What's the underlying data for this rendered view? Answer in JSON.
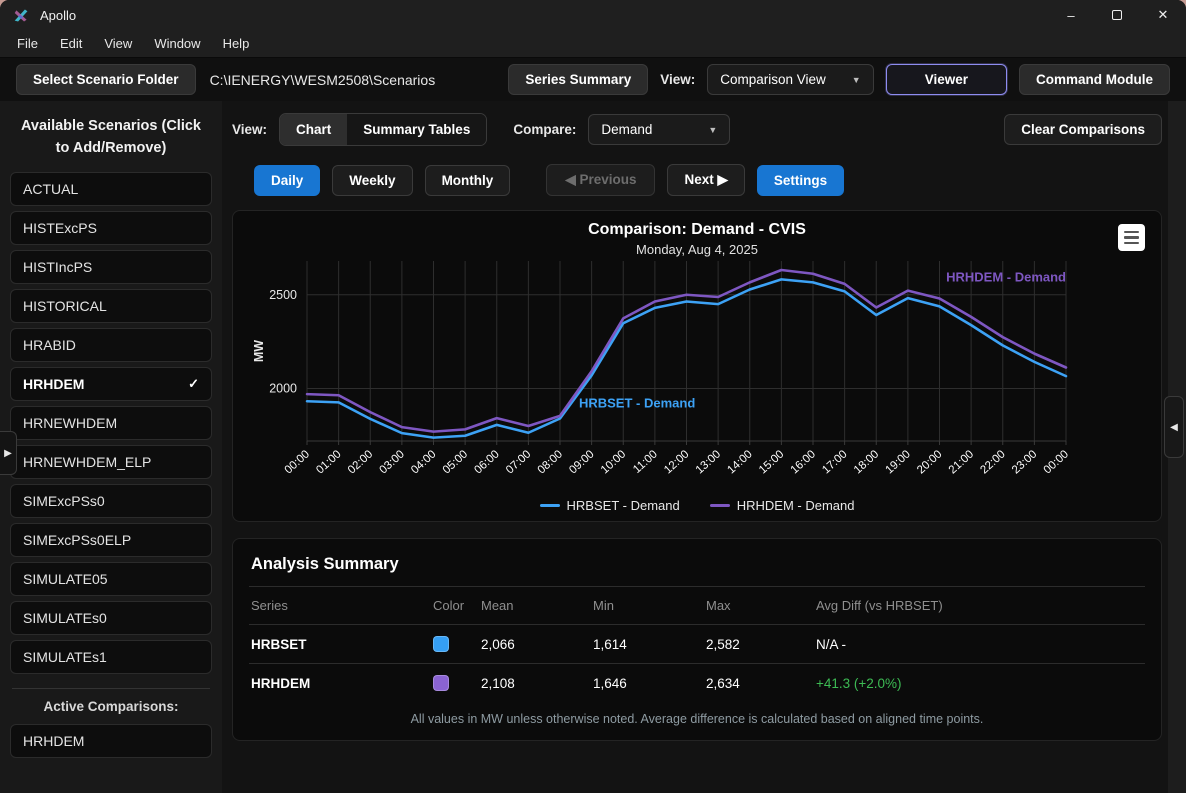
{
  "window": {
    "title": "Apollo",
    "minimize_glyph": "–",
    "close_glyph": "✕"
  },
  "menu": {
    "items": [
      "File",
      "Edit",
      "View",
      "Window",
      "Help"
    ]
  },
  "toolbar": {
    "select_folder": "Select Scenario Folder",
    "path": "C:\\IENERGY\\WESM2508\\Scenarios",
    "series_summary": "Series Summary",
    "view_label": "View:",
    "view_dropdown_value": "Comparison View",
    "dropdown_caret": "▼",
    "viewer": "Viewer",
    "command_module": "Command Module"
  },
  "sidebar": {
    "title": "Available Scenarios (Click to Add/Remove)",
    "check_glyph": "✓",
    "items": [
      {
        "label": "ACTUAL",
        "checked": false
      },
      {
        "label": "HISTExcPS",
        "checked": false
      },
      {
        "label": "HISTIncPS",
        "checked": false
      },
      {
        "label": "HISTORICAL",
        "checked": false
      },
      {
        "label": "HRABID",
        "checked": false
      },
      {
        "label": "HRHDEM",
        "checked": true
      },
      {
        "label": "HRNEWHDEM",
        "checked": false
      },
      {
        "label": "HRNEWHDEM_ELP",
        "checked": false
      },
      {
        "label": "SIMExcPSs0",
        "checked": false
      },
      {
        "label": "SIMExcPSs0ELP",
        "checked": false
      },
      {
        "label": "SIMULATE05",
        "checked": false
      },
      {
        "label": "SIMULATEs0",
        "checked": false
      },
      {
        "label": "SIMULATEs1",
        "checked": false
      }
    ],
    "active_comparisons_label": "Active Comparisons:",
    "active_items": [
      "HRHDEM"
    ]
  },
  "controls": {
    "view_label": "View:",
    "tabs": [
      {
        "label": "Chart",
        "active": true
      },
      {
        "label": "Summary Tables",
        "active": false
      }
    ],
    "compare_label": "Compare:",
    "compare_value": "Demand",
    "clear_button": "Clear Comparisons",
    "daily": "Daily",
    "weekly": "Weekly",
    "monthly": "Monthly",
    "previous": "◀ Previous",
    "next": "Next ▶",
    "settings": "Settings"
  },
  "chart_data": {
    "type": "line",
    "title": "Comparison: Demand - CVIS",
    "subtitle": "Monday, Aug 4, 2025",
    "ylabel": "MW",
    "x": [
      "00:00",
      "01:00",
      "02:00",
      "03:00",
      "04:00",
      "05:00",
      "06:00",
      "07:00",
      "08:00",
      "09:00",
      "10:00",
      "11:00",
      "12:00",
      "13:00",
      "14:00",
      "15:00",
      "16:00",
      "17:00",
      "18:00",
      "19:00",
      "20:00",
      "21:00",
      "22:00",
      "23:00",
      "00:00"
    ],
    "series": [
      {
        "name": "HRBSET - Demand",
        "color": "#3da2f5",
        "values": [
          1932,
          1926,
          1838,
          1762,
          1738,
          1748,
          1806,
          1764,
          1840,
          2070,
          2348,
          2430,
          2464,
          2450,
          2528,
          2582,
          2566,
          2518,
          2392,
          2482,
          2438,
          2338,
          2230,
          2142,
          2066
        ]
      },
      {
        "name": "HRHDEM - Demand",
        "color": "#7e57c2",
        "values": [
          1970,
          1964,
          1874,
          1794,
          1770,
          1782,
          1842,
          1800,
          1854,
          2092,
          2374,
          2464,
          2500,
          2488,
          2566,
          2632,
          2612,
          2558,
          2432,
          2522,
          2480,
          2382,
          2274,
          2186,
          2112
        ]
      }
    ],
    "yticks": [
      2000,
      2500
    ],
    "ylim": [
      1720,
      2680
    ],
    "grid": true,
    "legend_position": "bottom",
    "inline_labels": [
      {
        "text": "HRBSET - Demand",
        "color": "#3da2f5",
        "hour": 8.6,
        "mw": 1900,
        "anchor": "start"
      },
      {
        "text": "HRHDEM - Demand",
        "color": "#7e57c2",
        "hour": 24,
        "mw": 2570,
        "anchor": "end"
      }
    ]
  },
  "analysis": {
    "title": "Analysis Summary",
    "columns": [
      "Series",
      "Color",
      "Mean",
      "Min",
      "Max",
      "Avg Diff (vs HRBSET)"
    ],
    "rows": [
      {
        "series": "HRBSET",
        "color": "#359ff4",
        "mean": "2,066",
        "min": "1,614",
        "max": "2,582",
        "avg_diff": "N/A -",
        "diff_color": "#ffffff"
      },
      {
        "series": "HRHDEM",
        "color": "#8a63d2",
        "mean": "2,108",
        "min": "1,646",
        "max": "2,634",
        "avg_diff": "+41.3 (+2.0%)",
        "diff_color": "#3dbb54"
      }
    ],
    "footnote": "All values in MW unless otherwise noted. Average difference is calculated based on aligned time points."
  },
  "toggles": {
    "right_collapse_glyph": "◀",
    "left_expand_glyph": "▶"
  },
  "colors": {
    "accent_blue": "#1876d2",
    "line_blue": "#3da2f5",
    "line_purple": "#7e57c2",
    "positive_green": "#3dbb54",
    "viewer_border": "#8e8cf0"
  }
}
